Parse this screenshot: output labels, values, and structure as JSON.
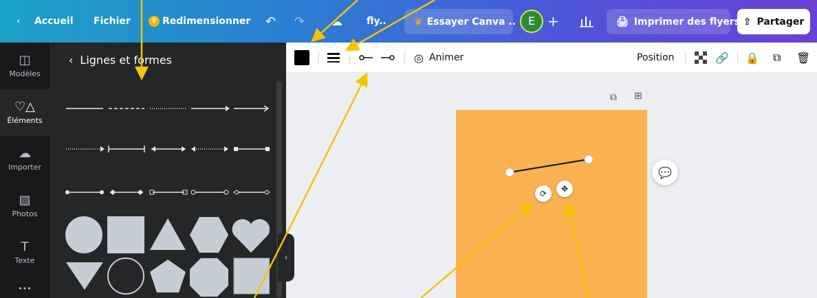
{
  "topbar": {
    "home": "Accueil",
    "file": "Fichier",
    "resize": "Redimensionner",
    "doc_title": "fly..",
    "try_canva": "Essayer Canva ..",
    "avatar_letter": "E",
    "print": "Imprimer des flyers",
    "share": "Partager"
  },
  "rail": [
    {
      "label": "Modèles",
      "icon": "templates-icon"
    },
    {
      "label": "Éléments",
      "icon": "elements-icon"
    },
    {
      "label": "Importer",
      "icon": "upload-icon"
    },
    {
      "label": "Photos",
      "icon": "photos-icon"
    },
    {
      "label": "Texte",
      "icon": "text-icon"
    }
  ],
  "panel": {
    "title": "Lignes et formes"
  },
  "toolbar": {
    "animate": "Animer",
    "position": "Position"
  },
  "colors": {
    "accent": "#fbb252",
    "arrow": "#f5c400",
    "swatch": "#000000"
  }
}
